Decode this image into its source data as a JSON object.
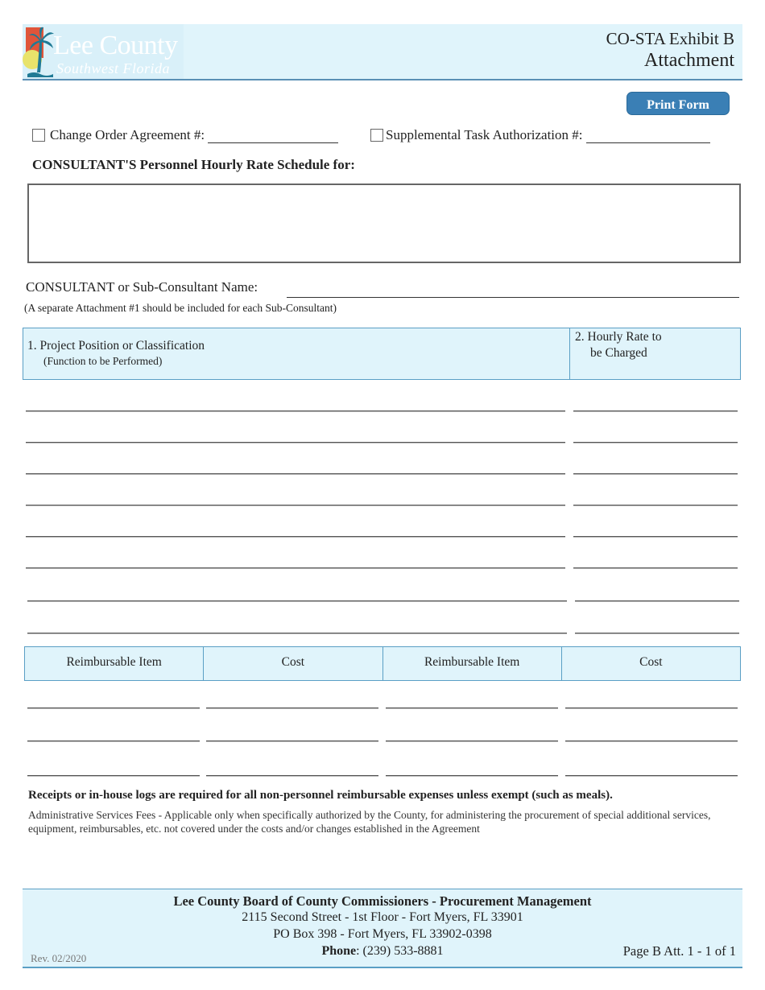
{
  "header": {
    "logo_title": "Lee County",
    "logo_subtitle": "Southwest Florida",
    "title_line1": "CO-STA Exhibit B",
    "title_line2": "Attachment"
  },
  "toolbar": {
    "print_label": "Print Form"
  },
  "agreement": {
    "change_order_label": "Change Order Agreement #:",
    "change_order_value": "",
    "change_order_checked": false,
    "sta_label": "Supplemental Task Authorization #:",
    "sta_value": "",
    "sta_checked": false
  },
  "schedule": {
    "title": "CONSULTANT'S Personnel Hourly Rate Schedule for:",
    "value": ""
  },
  "consultant": {
    "label": "CONSULTANT or Sub-Consultant Name:",
    "value": "",
    "note": "(A separate Attachment #1 should be included for each Sub-Consultant)"
  },
  "rate_table": {
    "col1_label": "1.  Project Position or Classification",
    "col1_sublabel": "(Function to be Performed)",
    "col2_label_line1": "2.  Hourly Rate to",
    "col2_label_line2": "be Charged",
    "rows": [
      {
        "position": "",
        "rate": ""
      },
      {
        "position": "",
        "rate": ""
      },
      {
        "position": "",
        "rate": ""
      },
      {
        "position": "",
        "rate": ""
      },
      {
        "position": "",
        "rate": ""
      },
      {
        "position": "",
        "rate": ""
      },
      {
        "position": "",
        "rate": ""
      },
      {
        "position": "",
        "rate": ""
      }
    ]
  },
  "reimbursable_table": {
    "headers": [
      "Reimbursable Item",
      "Cost",
      "Reimbursable Item",
      "Cost"
    ],
    "rows": [
      [
        "",
        "",
        "",
        ""
      ],
      [
        "",
        "",
        "",
        ""
      ],
      [
        "",
        "",
        "",
        ""
      ]
    ]
  },
  "notes": {
    "receipts": "Receipts or in-house logs are required for all non-personnel reimbursable expenses unless exempt (such as meals).",
    "admin": "Administrative Services Fees - Applicable only when specifically authorized by the County, for administering the procurement of special additional services, equipment, reimbursables, etc. not covered under the costs and/or changes established in the Agreement"
  },
  "footer": {
    "org": "Lee County Board of County Commissioners - Procurement Management",
    "address1": "2115 Second Street - 1st Floor - Fort Myers, FL 33901",
    "address2": "PO Box 398 - Fort Myers, FL 33902-0398",
    "phone_label": "Phone",
    "phone_value": ":  (239) 533-8881",
    "revision": "Rev. 02/2020",
    "page": "Page B Att. 1 - 1 of 1"
  },
  "colors": {
    "accent": "#3a7fb5",
    "header_bg": "#e0f4fb",
    "border_blue": "#5a9fc5"
  }
}
